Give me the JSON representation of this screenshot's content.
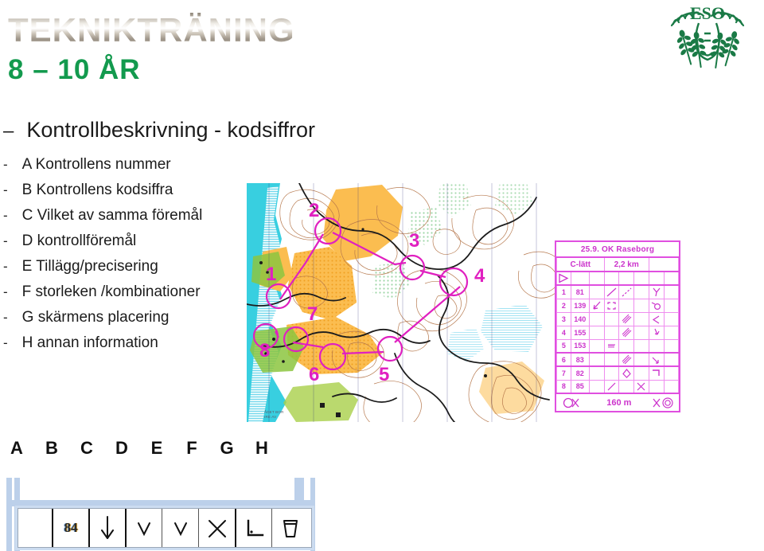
{
  "header": {
    "brand_title": "TEKNIKTRÄNING",
    "age_group": "8 – 10 ÅR",
    "logo_text": "ESO",
    "brand_green": "#139a4e",
    "magenta": "#cc33cc"
  },
  "content": {
    "heading_dash": "–",
    "heading": "Kontrollbeskrivning - kodsiffror",
    "bullets": [
      {
        "dash": "-",
        "text": "A Kontrollens nummer"
      },
      {
        "dash": "-",
        "text": "B Kontrollens kodsiffra"
      },
      {
        "dash": "-",
        "text": "C Vilket av samma föremål"
      },
      {
        "dash": "-",
        "text": "D kontrollföremål"
      },
      {
        "dash": "-",
        "text": "E Tillägg/precisering"
      },
      {
        "dash": "-",
        "text": "F storleken /kombinationer"
      },
      {
        "dash": "-",
        "text": "G skärmens placering"
      },
      {
        "dash": "-",
        "text": "H annan information"
      }
    ],
    "column_letters": [
      "A",
      "B",
      "C",
      "D",
      "E",
      "F",
      "G",
      "H"
    ]
  },
  "map": {
    "credit_line_1": "ÅDET BOR",
    "credit_line_2": "IRE AV",
    "control_numbers": [
      "1",
      "2",
      "3",
      "4",
      "5",
      "6",
      "7",
      "8"
    ]
  },
  "control_card": {
    "event_title": "25.9. OK Raseborg",
    "course_name": "C-lätt",
    "course_length": "2,2 km",
    "footer_length": "160 m",
    "rows": [
      {
        "num": "1",
        "code": "81",
        "c": "",
        "d": "slope-line",
        "e": "slope-dotted",
        "f": "",
        "g": "fork-symbol",
        "h": ""
      },
      {
        "num": "2",
        "code": "139",
        "c": "arrow-sw",
        "d": "square-brackets",
        "e": "",
        "f": "",
        "g": "loop-symbol",
        "h": ""
      },
      {
        "num": "3",
        "code": "140",
        "c": "",
        "d": "",
        "e": "hatched-bar",
        "f": "",
        "g": "angle-left",
        "h": ""
      },
      {
        "num": "4",
        "code": "155",
        "c": "",
        "d": "",
        "e": "hatched-bar",
        "f": "",
        "g": "bent-arrow",
        "h": ""
      },
      {
        "num": "5",
        "code": "153",
        "c": "",
        "d": "comb-symbol",
        "e": "",
        "f": "",
        "g": "",
        "h": ""
      },
      {
        "num": "6",
        "code": "83",
        "c": "",
        "d": "",
        "e": "hatched-bar",
        "f": "",
        "g": "branch-symbol",
        "h": ""
      },
      {
        "num": "7",
        "code": "82",
        "c": "",
        "d": "",
        "e": "diamond-symbol",
        "f": "",
        "g": "corner-symbol",
        "h": ""
      },
      {
        "num": "8",
        "code": "85",
        "c": "",
        "d": "slope-line",
        "e": "",
        "f": "cross-symbol",
        "g": "",
        "h": ""
      }
    ]
  },
  "symbol_strip": {
    "cells": [
      {
        "kind": "text",
        "value": "84"
      },
      {
        "kind": "icon",
        "value": "down-arrow-icon"
      },
      {
        "kind": "icon",
        "value": "vee-icon"
      },
      {
        "kind": "icon",
        "value": "vee-icon"
      },
      {
        "kind": "icon",
        "value": "cross-icon"
      },
      {
        "kind": "icon",
        "value": "corner-icon"
      },
      {
        "kind": "icon",
        "value": "trough-icon"
      }
    ]
  }
}
